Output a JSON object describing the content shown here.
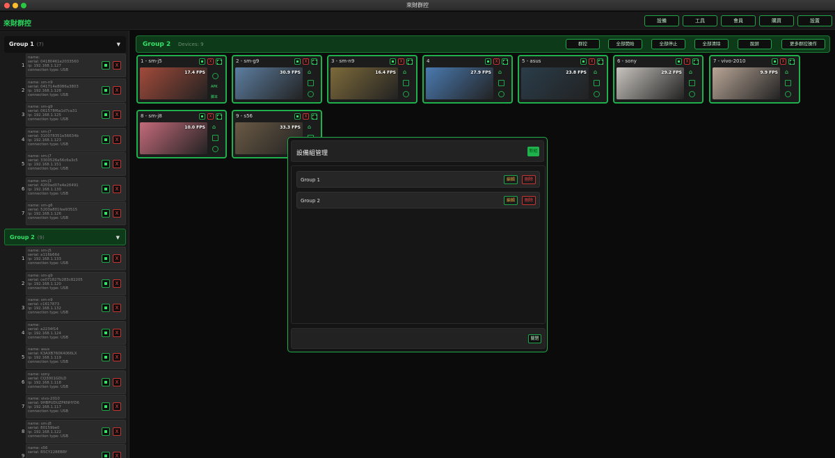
{
  "window": {
    "title": "來財群控"
  },
  "app": {
    "title": "來財群控"
  },
  "topbar": [
    "設備",
    "工具",
    "會員",
    "購買",
    "設置"
  ],
  "sidebar": {
    "groups": [
      {
        "name": "Group 1",
        "count": "(7)",
        "devices": [
          {
            "num": "1",
            "name": "name:",
            "serial": "serial: 04180461e2033560",
            "ip": "ip: 192.168.1.127",
            "conn": "connection type: USB"
          },
          {
            "num": "2",
            "name": "name: sm-n9",
            "serial": "serial: 041714e8086a3803",
            "ip": "ip: 192.168.1.128",
            "conn": "connection type: USB"
          },
          {
            "num": "3",
            "name": "name: sm-g9",
            "serial": "serial: 061578f6a1d7ca31",
            "ip": "ip: 192.168.1.125",
            "conn": "connection type: USB"
          },
          {
            "num": "4",
            "name": "name: sm-j7",
            "serial": "serial: 310078351e56634b",
            "ip": "ip: 192.168.1.123",
            "conn": "connection type: USB"
          },
          {
            "num": "5",
            "name": "name: sm-j7",
            "serial": "serial: 3300526a56c6a3c5",
            "ip": "ip: 192.168.1.151",
            "conn": "connection type: USB"
          },
          {
            "num": "6",
            "name": "name: sm-j3",
            "serial": "serial: 4200ad07e4e26491",
            "ip": "ip: 192.168.1.130",
            "conn": "connection type: USB"
          },
          {
            "num": "7",
            "name": "name: sm-g6",
            "serial": "serial: 5200a801fee93515",
            "ip": "ip: 192.168.1.126",
            "conn": "connection type: USB"
          }
        ]
      },
      {
        "name": "Group 2",
        "count": "(9)",
        "devices": [
          {
            "num": "1",
            "name": "name: sm-j5",
            "serial": "serial: a116b66d",
            "ip": "ip: 192.168.1.133",
            "conn": "connection type: USB"
          },
          {
            "num": "2",
            "name": "name: sm-g9",
            "serial": "serial: ce071827b283c82205",
            "ip": "ip: 192.168.1.120",
            "conn": "connection type: USB"
          },
          {
            "num": "3",
            "name": "name: sm-n9",
            "serial": "serial: c1617873",
            "ip": "ip: 192.168.1.132",
            "conn": "connection type: USB"
          },
          {
            "num": "4",
            "name": "name:",
            "serial": "serial: a2234f14",
            "ip": "ip: 192.168.1.124",
            "conn": "connection type: USB"
          },
          {
            "num": "5",
            "name": "name: asus",
            "serial": "serial: K3AXB760K4066LX",
            "ip": "ip: 192.168.1.119",
            "conn": "connection type: USB"
          },
          {
            "num": "6",
            "name": "name: sony",
            "serial": "serial: CQ3001GDLD",
            "ip": "ip: 192.168.1.118",
            "conn": "connection type: USB"
          },
          {
            "num": "7",
            "name": "name: vivo-2010",
            "serial": "serial: 9HBPUDUZPKNHYD6",
            "ip": "ip: 192.168.1.117",
            "conn": "connection type: USB"
          },
          {
            "num": "8",
            "name": "name: sm-j8",
            "serial": "serial: 80159be0",
            "ip": "ip: 192.168.1.122",
            "conn": "connection type: USB"
          },
          {
            "num": "9",
            "name": "name: s56",
            "serial": "serial: R5CY228EBRY",
            "ip": "",
            "conn": ""
          }
        ]
      }
    ],
    "close_glyph": "X"
  },
  "main": {
    "title": "Group 2",
    "count": "Devices: 9",
    "actions": [
      "群控",
      "全部開始",
      "全部停止",
      "全部清除",
      "脫屏",
      "更多群控操作"
    ],
    "cards": [
      {
        "title": "1 - sm-j5",
        "fps": "17.4 FPS",
        "bg": "#a24a3a"
      },
      {
        "title": "2 - sm-g9",
        "fps": "30.9 FPS",
        "bg": "#5d7ea0"
      },
      {
        "title": "3 - sm-n9",
        "fps": "16.4 FPS",
        "bg": "#7d6a3a"
      },
      {
        "title": "4",
        "fps": "27.9 FPS",
        "bg": "#4a7ab0"
      },
      {
        "title": "5 - asus",
        "fps": "23.8 FPS",
        "bg": "#2a3d4a"
      },
      {
        "title": "6 - sony",
        "fps": "29.2 FPS",
        "bg": "#c8c4be"
      },
      {
        "title": "7 - vivo-2010",
        "fps": "9.9 FPS",
        "bg": "#b8a596"
      },
      {
        "title": "8 - sm-j8",
        "fps": "10.0 FPS",
        "bg": "#c36a7a"
      },
      {
        "title": "9 - s56",
        "fps": "33.3 FPS",
        "bg": "#6a5a45"
      }
    ],
    "apk_label": "APK",
    "apk_label2": "脚本"
  },
  "modal": {
    "title": "設備組管理",
    "new_label": "新組",
    "groups": [
      {
        "name": "Group 1"
      },
      {
        "name": "Group 2"
      }
    ],
    "edit_label": "編輯",
    "delete_label": "刪除",
    "close_label": "關閉"
  }
}
